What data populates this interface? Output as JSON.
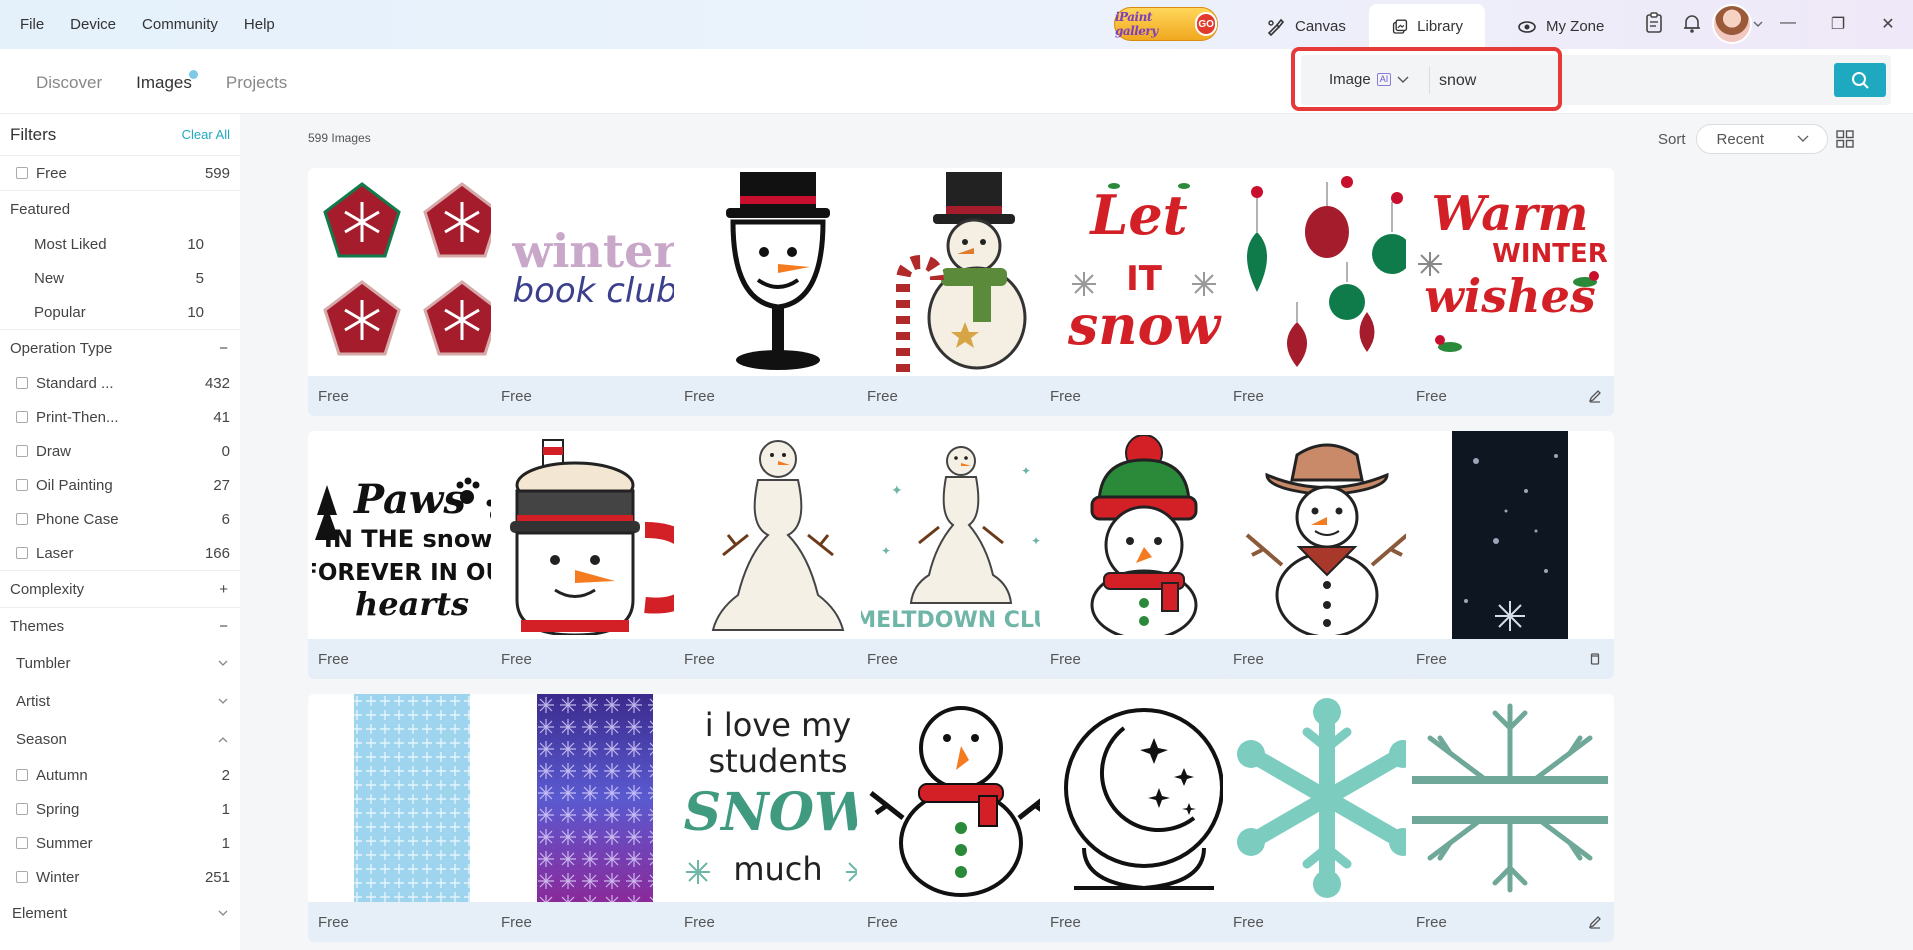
{
  "menu": [
    "File",
    "Device",
    "Community",
    "Help"
  ],
  "brand": {
    "logo_text": "iPaint gallery",
    "go": "GO"
  },
  "top_tabs": [
    {
      "label": "Canvas",
      "icon": "palette-brush-icon"
    },
    {
      "label": "Library",
      "icon": "library-icon"
    },
    {
      "label": "My Zone",
      "icon": "my-zone-icon"
    }
  ],
  "subnav": {
    "tabs": [
      "Discover",
      "Images",
      "Projects"
    ],
    "active": "Images"
  },
  "search": {
    "type_label": "Image",
    "ai_tag": "AI",
    "query": "snow"
  },
  "filters": {
    "title": "Filters",
    "clear_all": "Clear All",
    "free": {
      "label": "Free",
      "count": "599"
    },
    "featured": {
      "title": "Featured",
      "items": [
        {
          "label": "Most Liked",
          "count": "10"
        },
        {
          "label": "New",
          "count": "5"
        },
        {
          "label": "Popular",
          "count": "10"
        }
      ]
    },
    "operation_type": {
      "title": "Operation Type",
      "toggle": "−",
      "items": [
        {
          "label": "Standard ...",
          "count": "432"
        },
        {
          "label": "Print-Then...",
          "count": "41"
        },
        {
          "label": "Draw",
          "count": "0"
        },
        {
          "label": "Oil Painting",
          "count": "27"
        },
        {
          "label": "Phone Case",
          "count": "6"
        },
        {
          "label": "Laser",
          "count": "166"
        }
      ]
    },
    "complexity": {
      "title": "Complexity",
      "toggle": "+"
    },
    "themes": {
      "title": "Themes",
      "toggle": "−",
      "groups": [
        "Tumbler",
        "Artist"
      ]
    },
    "season": {
      "title": "Season",
      "items": [
        {
          "label": "Autumn",
          "count": "2"
        },
        {
          "label": "Spring",
          "count": "1"
        },
        {
          "label": "Summer",
          "count": "1"
        },
        {
          "label": "Winter",
          "count": "251"
        }
      ]
    },
    "element": {
      "title": "Element"
    }
  },
  "results": {
    "count_label": "599 Images",
    "sort_label": "Sort",
    "sort_value": "Recent",
    "cards": [
      {
        "label": "Free",
        "art": "snowflake-pentagons",
        "action": "edit"
      },
      {
        "label": "Free",
        "art": "winter-book-club",
        "action": "edit"
      },
      {
        "label": "Free",
        "art": "snowman-wine-glass",
        "action": "edit"
      },
      {
        "label": "Free",
        "art": "snowman-candy-cane",
        "action": "edit"
      },
      {
        "label": "Free",
        "art": "let-it-snow",
        "action": "edit"
      },
      {
        "label": "Free",
        "art": "christmas-ornaments",
        "action": "edit"
      },
      {
        "label": "Free",
        "art": "warm-winter-wishes",
        "action": "edit"
      },
      {
        "label": "Free",
        "art": "paws-in-the-snow",
        "action": "edit"
      },
      {
        "label": "Free",
        "art": "snowman-mug",
        "action": "edit"
      },
      {
        "label": "Free",
        "art": "melting-snowman",
        "action": "edit"
      },
      {
        "label": "Free",
        "art": "meltdown-club",
        "action": "edit"
      },
      {
        "label": "Free",
        "art": "snowman-beanie",
        "action": "edit"
      },
      {
        "label": "Free",
        "art": "snowman-cowboy",
        "action": "edit"
      },
      {
        "label": "Free",
        "art": "night-snow-tumbler",
        "action": "tumbler"
      },
      {
        "label": "Free",
        "art": "blue-snowflake-pattern",
        "action": "tumbler"
      },
      {
        "label": "Free",
        "art": "purple-snowflake-pattern",
        "action": "tumbler"
      },
      {
        "label": "Free",
        "art": "i-love-my-students",
        "action": "edit"
      },
      {
        "label": "Free",
        "art": "snowman-scarf",
        "action": "edit"
      },
      {
        "label": "Free",
        "art": "moon-snow-globe",
        "action": "edit"
      },
      {
        "label": "Free",
        "art": "teal-snowflake",
        "action": "edit"
      },
      {
        "label": "Free",
        "art": "split-snowflake",
        "action": "edit"
      }
    ],
    "art_text": {
      "winter": "winter",
      "book_club": "book club",
      "let": "Let",
      "it": "IT",
      "snow": "snow",
      "warm": "Warm",
      "winter_caps": "WINTER",
      "wishes": "wishes",
      "paws": "Paws",
      "in_the_snow": "IN THE snow,",
      "forever": "FOREVER IN OUR",
      "hearts": "hearts",
      "meltdown": "MELTDOWN CLUB",
      "love": "i love my",
      "students": "students",
      "snow_caps": "SNOW",
      "much": "much"
    }
  },
  "colors": {
    "accent": "#1fa9c1",
    "highlight": "#e5393a",
    "card_footer": "#e6eef8",
    "christmas_red": "#c8102e",
    "christmas_green": "#0f7a4a"
  }
}
